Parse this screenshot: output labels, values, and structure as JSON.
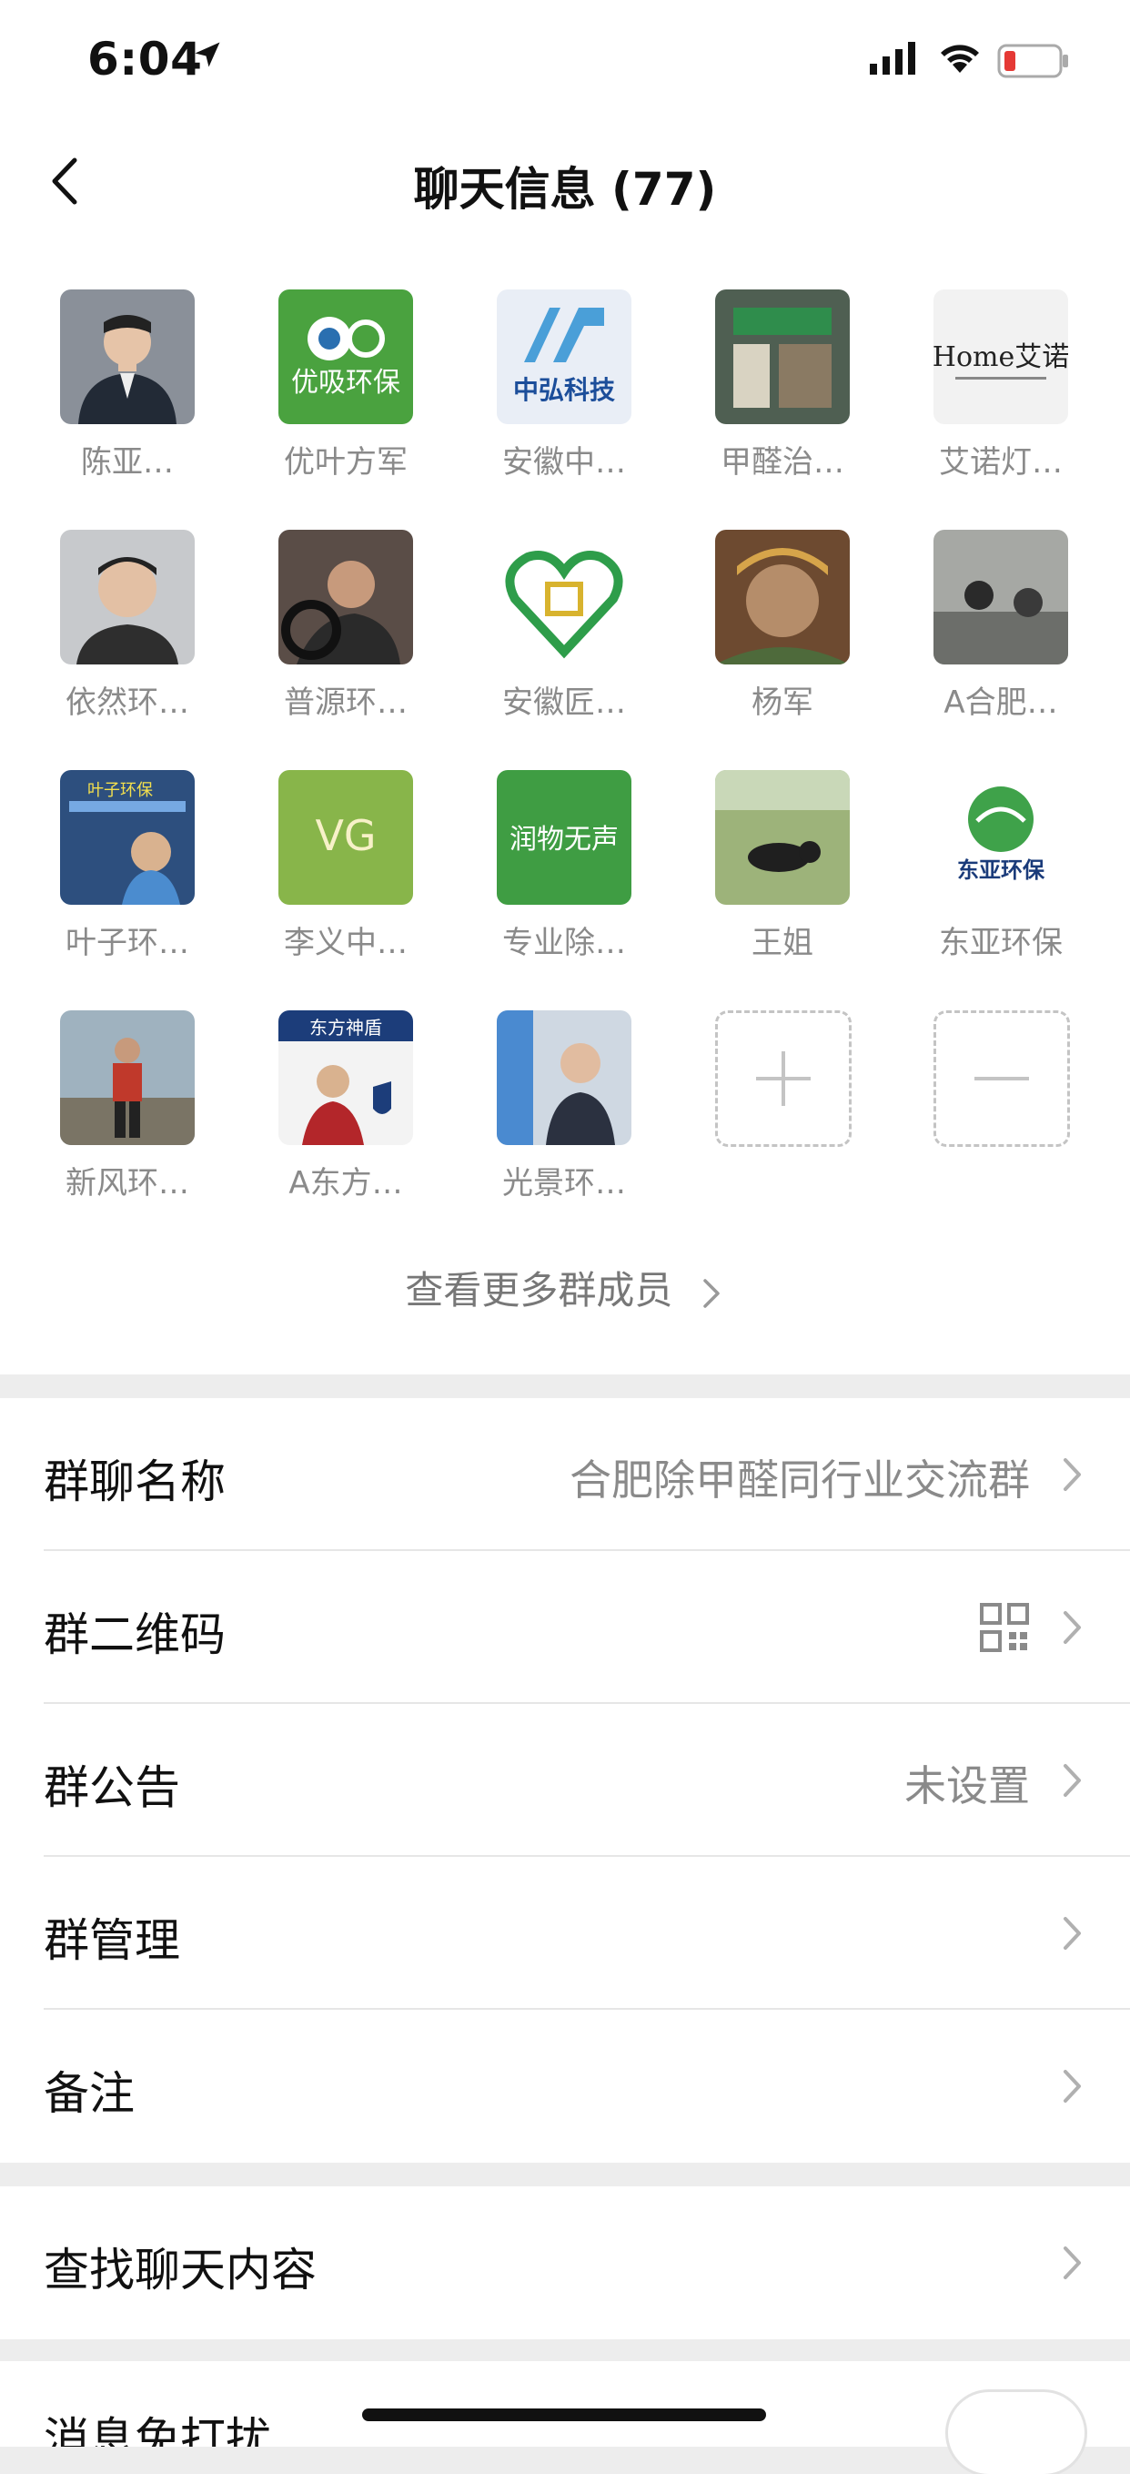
{
  "status_bar": {
    "time": "6:04"
  },
  "nav": {
    "title": "聊天信息 (77)"
  },
  "members": [
    {
      "name": "陈亚…",
      "color": "#6a6f78"
    },
    {
      "name": "优叶方军",
      "color": "#4aa23f",
      "logo_text": "优吸环保"
    },
    {
      "name": "安徽中…",
      "color": "#e9eef6",
      "logo_text": "中弘科技"
    },
    {
      "name": "甲醛治…",
      "color": "#5f7a62"
    },
    {
      "name": "艾诺灯…",
      "color": "#f2f2f2",
      "logo_text": "Home艾诺"
    },
    {
      "name": "依然环…",
      "color": "#8b8f95"
    },
    {
      "name": "普源环…",
      "color": "#5a4d47"
    },
    {
      "name": "安徽匠…",
      "color": "#ffffff"
    },
    {
      "name": "杨军",
      "color": "#8a5a3a"
    },
    {
      "name": "A合肥…",
      "color": "#a6a8a4"
    },
    {
      "name": "叶子环…",
      "color": "#2d4f7e",
      "logo_text": "叶子环保"
    },
    {
      "name": "李义中…",
      "color": "#88b54a",
      "logo_text": "VG"
    },
    {
      "name": "专业除…",
      "color": "#3f9d43",
      "logo_text": "润物无声"
    },
    {
      "name": "王姐",
      "color": "#7f9a55"
    },
    {
      "name": "东亚环保",
      "color": "#ffffff",
      "logo_text": "东亚环保"
    },
    {
      "name": "新风环…",
      "color": "#6f7f8a"
    },
    {
      "name": "A东方…",
      "color": "#f3f3f3",
      "logo_text": "东方神盾"
    },
    {
      "name": "光景环…",
      "color": "#6e9bd2"
    }
  ],
  "see_more": "查看更多群成员",
  "settings_group1": [
    {
      "label": "群聊名称",
      "value": "合肥除甲醛同行业交流群"
    },
    {
      "label": "群二维码",
      "value": ""
    },
    {
      "label": "群公告",
      "value": "未设置"
    },
    {
      "label": "群管理",
      "value": ""
    },
    {
      "label": "备注",
      "value": ""
    }
  ],
  "settings_group2": [
    {
      "label": "查找聊天内容",
      "value": ""
    }
  ],
  "settings_group3": [
    {
      "label": "消息免打扰",
      "value": ""
    }
  ],
  "colors": {
    "background": "#ededed",
    "accent": "#4aa23f"
  }
}
